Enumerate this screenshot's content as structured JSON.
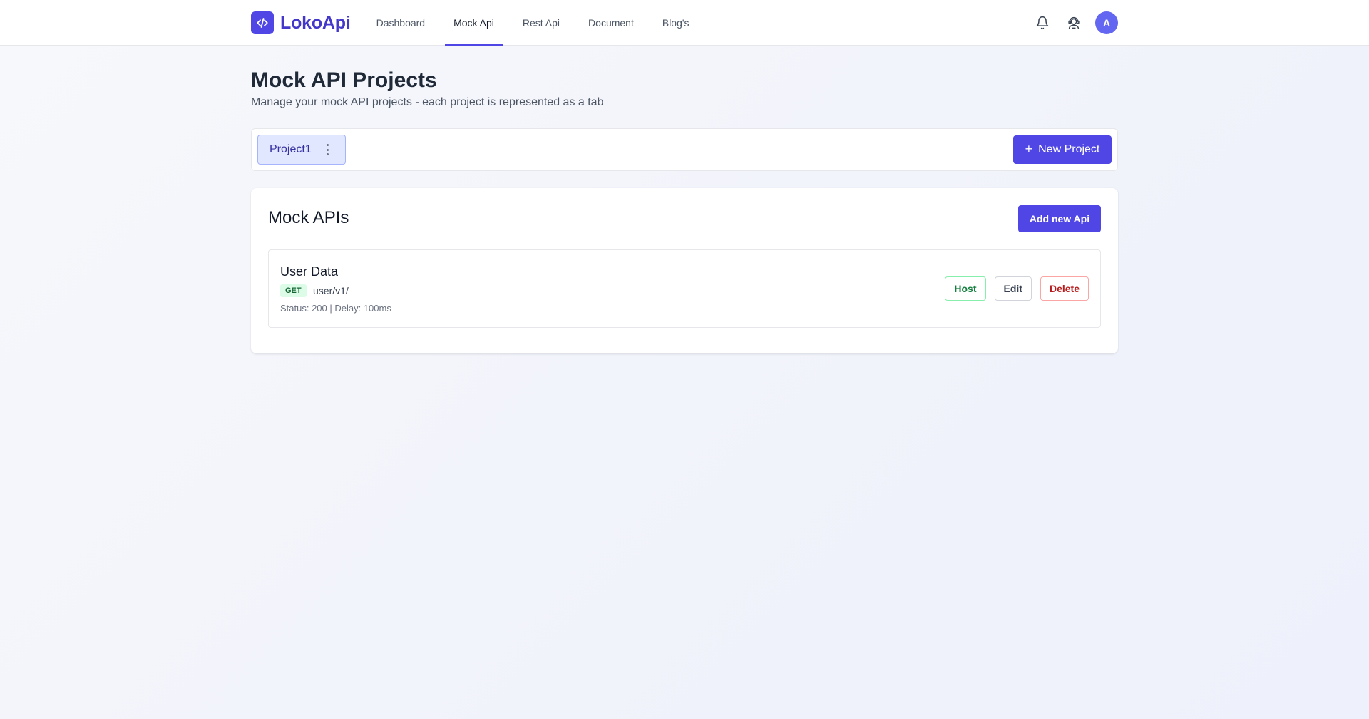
{
  "brand": {
    "name": "LokoApi",
    "logo_icon": "code-icon",
    "accent": "#4f46e5"
  },
  "nav": {
    "items": [
      {
        "label": "Dashboard",
        "active": false
      },
      {
        "label": "Mock Api",
        "active": true
      },
      {
        "label": "Rest Api",
        "active": false
      },
      {
        "label": "Document",
        "active": false
      },
      {
        "label": "Blog's",
        "active": false
      }
    ],
    "icons": [
      "bell-icon",
      "support-agent-icon"
    ],
    "avatar_initial": "A"
  },
  "page": {
    "title": "Mock API Projects",
    "subtitle": "Manage your mock API projects - each project is represented as a tab"
  },
  "projects": {
    "tabs": [
      {
        "label": "Project1",
        "active": true
      }
    ],
    "new_button_label": "New Project"
  },
  "mock_apis": {
    "title": "Mock APIs",
    "add_button_label": "Add new Api",
    "items": [
      {
        "name": "User Data",
        "method": "GET",
        "path": "user/v1/",
        "meta": "Status: 200 | Delay: 100ms",
        "actions": {
          "host": "Host",
          "edit": "Edit",
          "delete": "Delete"
        }
      }
    ]
  }
}
